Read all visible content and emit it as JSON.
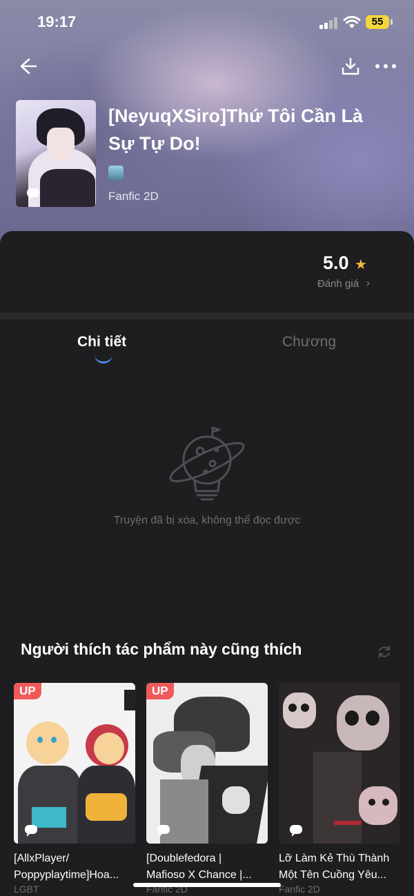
{
  "status_bar": {
    "time": "19:17",
    "battery": "55"
  },
  "header": {
    "back_icon": "back-arrow-icon",
    "download_icon": "download-icon",
    "more_icon": "more-dots-icon"
  },
  "story": {
    "title": "[NeyuqXSiro]Thứ Tôi Cần Là Sự Tự Do!",
    "category": "Fanfic 2D"
  },
  "rating": {
    "value": "5.0",
    "label": "Đánh giá",
    "chevron": "›"
  },
  "tabs": [
    {
      "label": "Chi tiết",
      "active": true
    },
    {
      "label": "Chương",
      "active": false
    }
  ],
  "empty_state": {
    "message": "Truyện đã bị xóa, không thể đọc được"
  },
  "recommendations": {
    "title": "Người thích tác phẩm này cũng thích",
    "items": [
      {
        "badge": "UP",
        "title_line1": "[AllxPlayer/",
        "title_line2": "Poppyplaytime]Hoa...",
        "category": "LGBT"
      },
      {
        "badge": "UP",
        "title_line1": "[Doublefedora |",
        "title_line2": "Mafioso X Chance |...",
        "category": "Fanfic 2D"
      },
      {
        "badge": "",
        "title_line1": "Lỡ Làm Kẻ Thù Thành",
        "title_line2": "Một Tên Cuồng Yêu...",
        "category": "Fanfic 2D"
      }
    ]
  },
  "colors": {
    "accent": "#4a8ff0",
    "star": "#f5b93a",
    "up_badge": "#f05a5a",
    "battery": "#f2d63c"
  }
}
